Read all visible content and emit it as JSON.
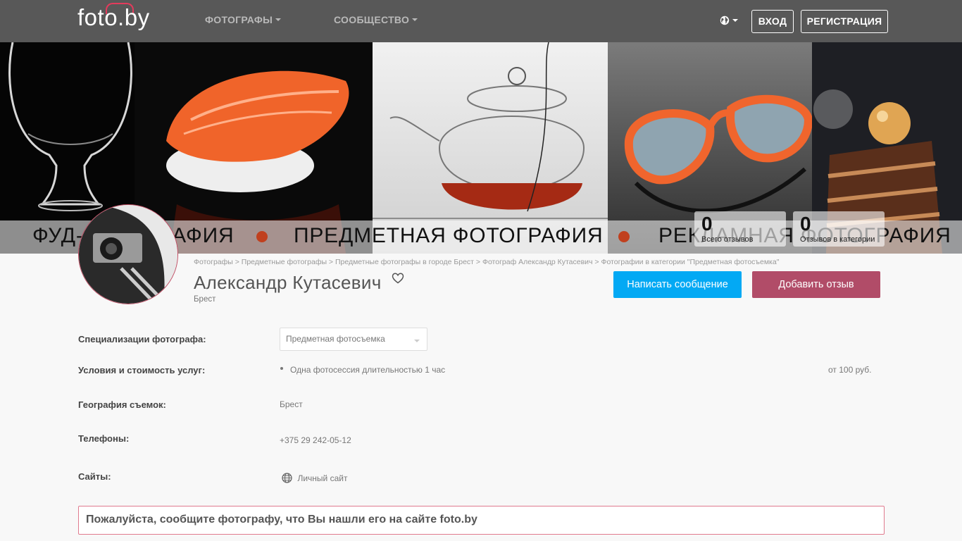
{
  "header": {
    "logo": "foto.by",
    "nav": [
      {
        "label": "ФОТОГРАФЫ"
      },
      {
        "label": "СООБЩЕСТВО"
      }
    ],
    "login_label": "ВХОД",
    "register_label": "РЕГИСТРАЦИЯ"
  },
  "banner": {
    "captions": [
      "ФУД-ФОТОГРАФИЯ",
      "ПРЕДМЕТНАЯ ФОТОГРАФИЯ",
      "РЕКЛАМНАЯ ФОТОГРАФИЯ"
    ],
    "stats": [
      {
        "value": "0",
        "label": "Всего отзывов"
      },
      {
        "value": "0",
        "label": "Отзывов в категории"
      }
    ]
  },
  "profile": {
    "breadcrumb": "Фотографы > Предметные фотографы > Предметные фотографы в городе Брест > Фотограф Александр Кутасевич > Фотографии в категории \"Предметная фотосъемка\"",
    "name": "Александр Кутасевич",
    "city": "Брест",
    "message_button": "Написать сообщение",
    "review_button": "Добавить отзыв"
  },
  "details": {
    "specialization_label": "Специализации фотографа:",
    "specialization_value": "Предметная фотосъемка",
    "services_label": "Условия и стоимость услуг:",
    "service_name": "Одна фотосессия длительностью 1 час",
    "service_price": "от 100 руб.",
    "geo_label": "География съемок:",
    "geo_value": "Брест",
    "phones_label": "Телефоны:",
    "phone": "+375 29 242-05-12",
    "sites_label": "Сайты:",
    "site_link": "Личный сайт"
  },
  "notice": "Пожалуйста, сообщите фотографу, что Вы нашли его на сайте foto.by",
  "colors": {
    "topbar": "#585858",
    "accent_blue": "#03a9f4",
    "accent_rose": "#b14c68",
    "logo_roof": "#e33b5c"
  }
}
